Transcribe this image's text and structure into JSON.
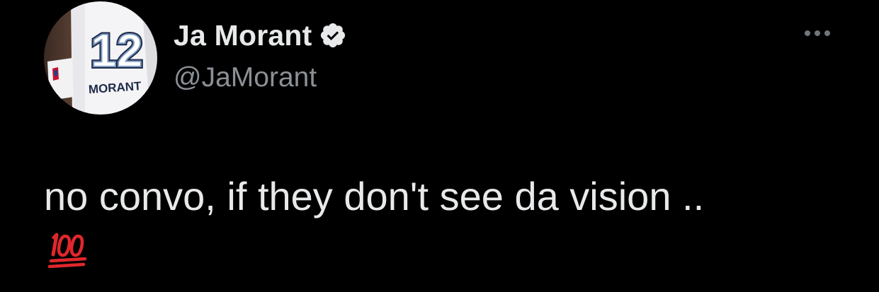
{
  "author": {
    "display_name": "Ja Morant",
    "handle": "@JaMorant",
    "verified": true,
    "avatar": {
      "jersey_number": "12",
      "jersey_name": "MORANT"
    }
  },
  "tweet": {
    "text": "no convo, if they don't see da vision ..",
    "emoji": "hundred-points-emoji"
  },
  "icons": {
    "verified": "verified-badge-icon",
    "more": "more-options-icon"
  },
  "colors": {
    "background": "#000000",
    "primary_text": "#e7e9ea",
    "secondary_text": "#8b9096",
    "emoji_red": "#e0272c"
  }
}
